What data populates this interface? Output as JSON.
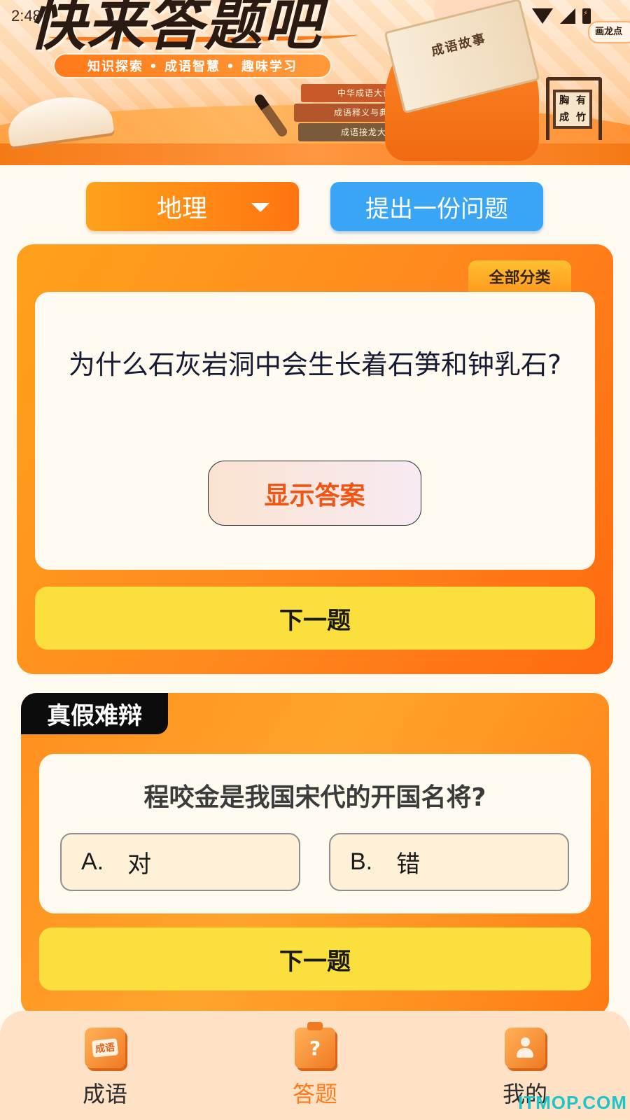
{
  "status_bar": {
    "time": "2:48"
  },
  "banner": {
    "title": "快来答题吧",
    "subtitle": "知识探索 • 成语智慧 • 趣味学习",
    "books": [
      "中华成语大词典",
      "成语释义与典故",
      "成语接龙大全"
    ],
    "reader_book_title": "成语故事",
    "plaque_chars": [
      "胸",
      "有",
      "成",
      "竹"
    ],
    "sticker": "画龙点"
  },
  "controls": {
    "category_value": "地理",
    "submit_question_label": "提出一份问题"
  },
  "qa_card": {
    "category_tag": "全部分类",
    "question": "为什么石灰岩洞中会生长着石笋和钟乳石?",
    "show_answer_label": "显示答案",
    "next_label": "下一题"
  },
  "true_false": {
    "title": "真假难辩",
    "question": "程咬金是我国宋代的开国名将?",
    "options": [
      {
        "letter": "A.",
        "text": "对"
      },
      {
        "letter": "B.",
        "text": "错"
      }
    ],
    "next_label": "下一题"
  },
  "bottom_nav": {
    "items": [
      {
        "label": "成语",
        "icon": "idiom-book-icon",
        "icon_text": "成语",
        "active": false
      },
      {
        "label": "答题",
        "icon": "quiz-clipboard-icon",
        "active": true
      },
      {
        "label": "我的",
        "icon": "profile-card-icon",
        "active": false
      }
    ],
    "active_color": "#ff7a1a"
  },
  "watermark": "ITMOP.COM"
}
